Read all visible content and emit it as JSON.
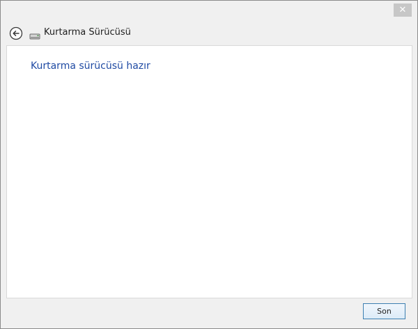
{
  "window": {
    "close_glyph": "✕"
  },
  "nav": {
    "back_icon": "back-arrow-icon",
    "drive_icon": "drive-icon",
    "title": "Kurtarma Sürücüsü"
  },
  "main": {
    "heading": "Kurtarma sürücüsü hazır",
    "heading_color": "#1f4aa3"
  },
  "footer": {
    "finish_label": "Son"
  }
}
